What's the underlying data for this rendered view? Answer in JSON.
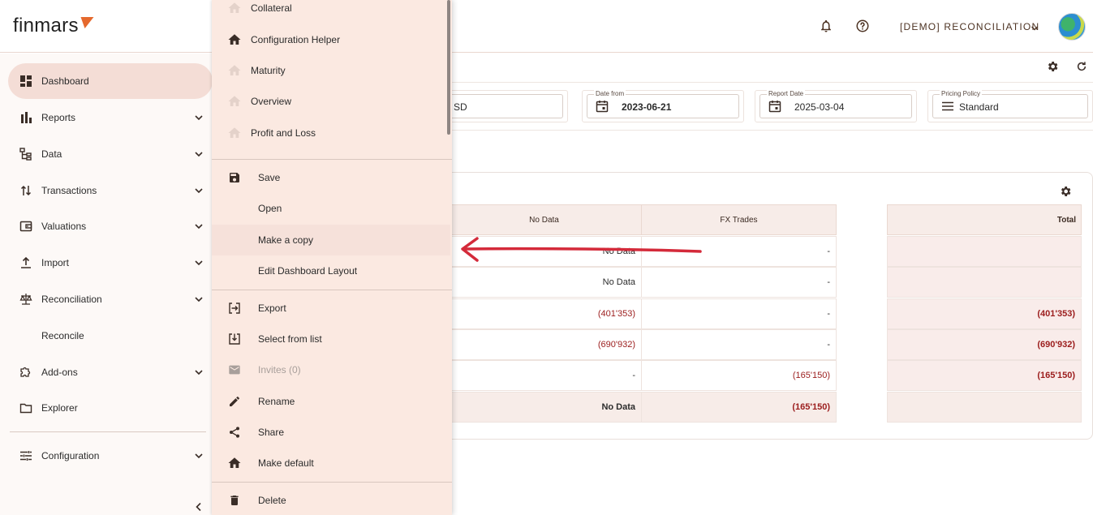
{
  "header": {
    "logo_text": "finmars",
    "org_name": "[DEMO] RECONCILIATION",
    "icons": [
      "bell-icon",
      "help-circle-icon",
      "chevron-down-icon"
    ],
    "accent": "#e5692d"
  },
  "sidebar": {
    "items": [
      {
        "label": "Dashboard",
        "icon": "dashboard-icon",
        "active": true
      },
      {
        "label": "Reports",
        "icon": "bar-chart-icon"
      },
      {
        "label": "Data",
        "icon": "tree-icon"
      },
      {
        "label": "Transactions",
        "icon": "swap-vertical-icon"
      },
      {
        "label": "Valuations",
        "icon": "wallet-icon"
      },
      {
        "label": "Import",
        "icon": "upload-icon"
      },
      {
        "label": "Reconciliation",
        "icon": "scale-icon"
      },
      {
        "label": "Reconcile",
        "icon": ""
      },
      {
        "label": "Add-ons",
        "icon": "puzzle-icon"
      },
      {
        "label": "Explorer",
        "icon": "folder-icon"
      },
      {
        "label": "Configuration",
        "icon": "sliders-icon"
      }
    ]
  },
  "filters": {
    "currency_value": "SD",
    "date_from_label": "Date from",
    "date_from_value": "2023-06-21",
    "report_date_label": "Report Date",
    "report_date_value": "2025-03-04",
    "pricing_policy_label": "Pricing Policy",
    "pricing_policy_value": "Standard"
  },
  "table": {
    "headers": [
      "No Data",
      "FX Trades",
      "Total"
    ],
    "rows": [
      {
        "c1": "No Data",
        "c2": "-",
        "total": ""
      },
      {
        "c1": "No Data",
        "c2": "-",
        "total": ""
      },
      {
        "c1": "(401'353)",
        "c2": "-",
        "total": "(401'353)"
      },
      {
        "c1": "(690'932)",
        "c2": "-",
        "total": "(690'932)"
      },
      {
        "c1": "-",
        "c2": "(165'150)",
        "total": "(165'150)"
      },
      {
        "c1": "No Data",
        "c2": "(165'150)",
        "total": ""
      }
    ]
  },
  "menu": {
    "layouts": [
      {
        "label": "Collateral",
        "icon": "home-icon",
        "faded": true
      },
      {
        "label": "Configuration Helper",
        "icon": "home-icon",
        "faded": false
      },
      {
        "label": "Maturity",
        "icon": "home-icon",
        "faded": true
      },
      {
        "label": "Overview",
        "icon": "home-icon",
        "faded": true
      },
      {
        "label": "Profit and Loss",
        "icon": "home-icon",
        "faded": true
      }
    ],
    "actions_a": [
      {
        "label": "Save",
        "icon": "save-icon"
      },
      {
        "label": "Open",
        "icon": ""
      },
      {
        "label": "Make a copy",
        "icon": ""
      },
      {
        "label": "Edit Dashboard Layout",
        "icon": ""
      }
    ],
    "actions_b": [
      {
        "label": "Export",
        "icon": "export-icon"
      },
      {
        "label": "Select from list",
        "icon": "import-icon"
      },
      {
        "label": "Invites (0)",
        "icon": "mail-icon",
        "disabled": true
      },
      {
        "label": "Rename",
        "icon": "pencil-icon"
      },
      {
        "label": "Share",
        "icon": "share-icon"
      },
      {
        "label": "Make default",
        "icon": "home-icon"
      }
    ],
    "actions_c": [
      {
        "label": "Delete",
        "icon": "trash-icon"
      }
    ]
  },
  "colors": {
    "negative": "#9b1c1c",
    "menu_bg": "#fbe9e1",
    "annotation_arrow": "#d42a3a"
  }
}
